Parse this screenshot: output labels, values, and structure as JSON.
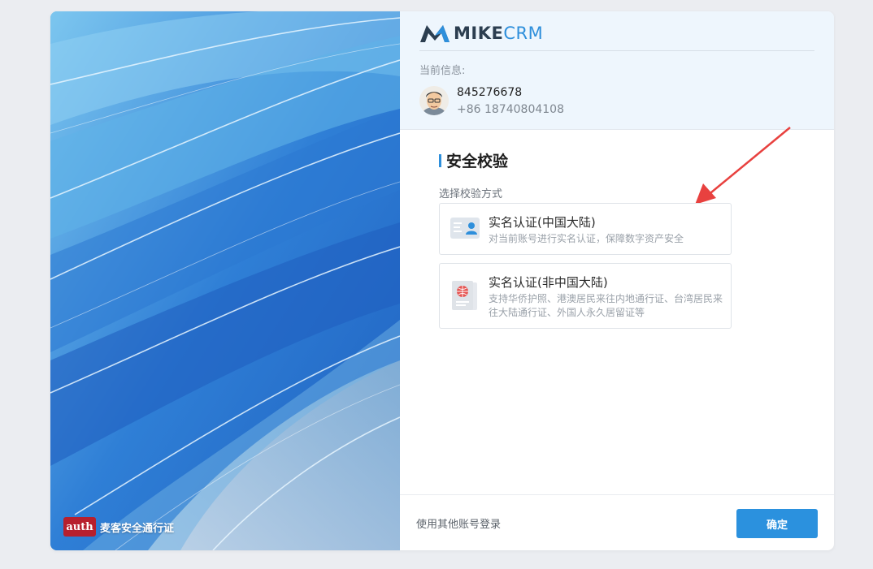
{
  "brand": {
    "mike": "MIKE",
    "crm": "CRM",
    "accent": "#2e8fdb"
  },
  "left_panel": {
    "auth_logo": "auth",
    "auth_label": "麦客安全通行证"
  },
  "header": {
    "current_info_label": "当前信息:",
    "user_id": "845276678",
    "phone": "+86 18740804108"
  },
  "section": {
    "title": "安全校验",
    "method_label": "选择校验方式"
  },
  "options": [
    {
      "title": "实名认证(中国大陆)",
      "desc": "对当前账号进行实名认证，保障数字资产安全",
      "icon": "id-card-icon"
    },
    {
      "title": "实名认证(非中国大陆)",
      "desc": "支持华侨护照、港澳居民来往内地通行证、台湾居民来往大陆通行证、外国人永久居留证等",
      "icon": "passport-icon"
    }
  ],
  "footer": {
    "other_login": "使用其他账号登录",
    "confirm": "确定"
  }
}
